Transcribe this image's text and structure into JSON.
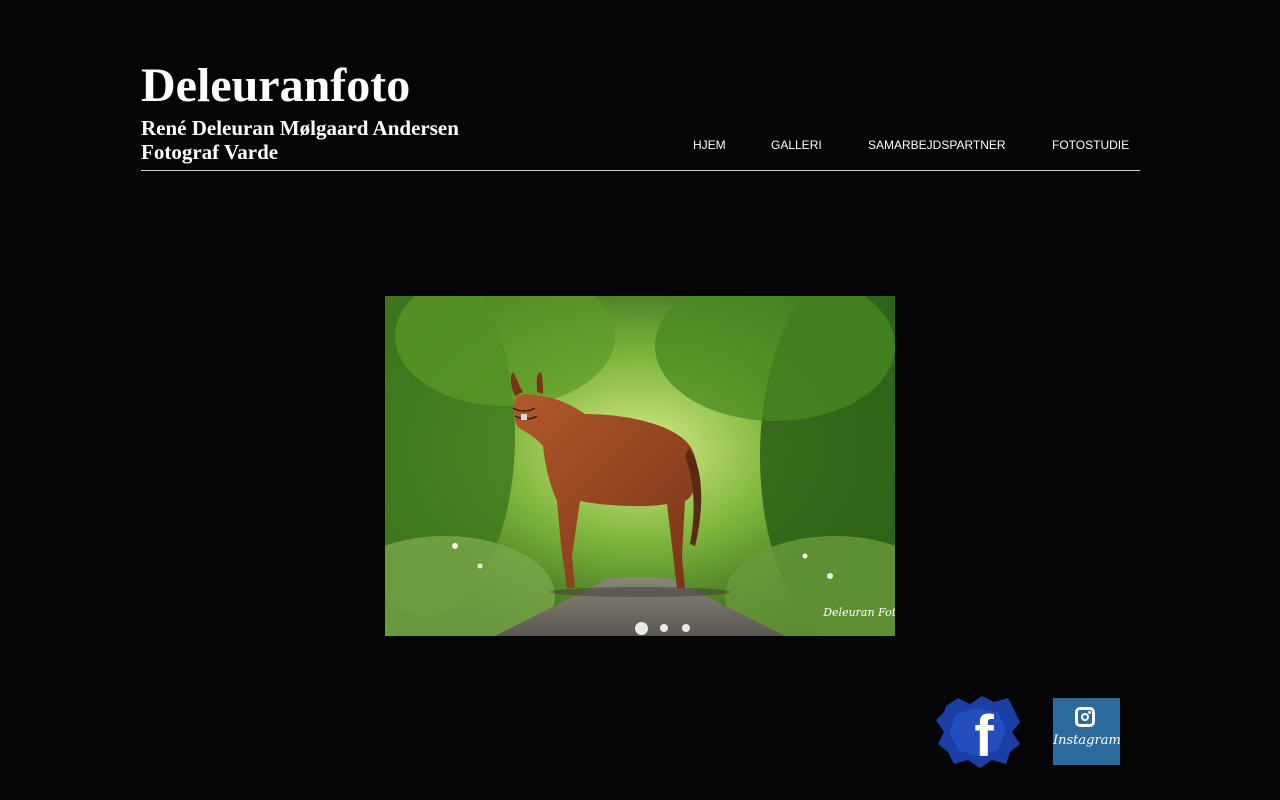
{
  "header": {
    "title": "Deleuranfoto",
    "subtitle_line1": "René Deleuran Mølgaard Andersen",
    "subtitle_line2": "Fotograf Varde"
  },
  "nav": {
    "items": [
      {
        "label": "HJEM"
      },
      {
        "label": "GALLERI"
      },
      {
        "label": "SAMARBEJDSPARTNER"
      },
      {
        "label": "FOTOSTUDIE"
      }
    ]
  },
  "slideshow": {
    "slide_count": 3,
    "active_index": 0,
    "watermark": "Deleuran Foto"
  },
  "social": {
    "facebook_letter": "f",
    "instagram_label": "Instagram",
    "facebook_color": "#1a3fa6",
    "instagram_color": "#2b6a9a"
  }
}
